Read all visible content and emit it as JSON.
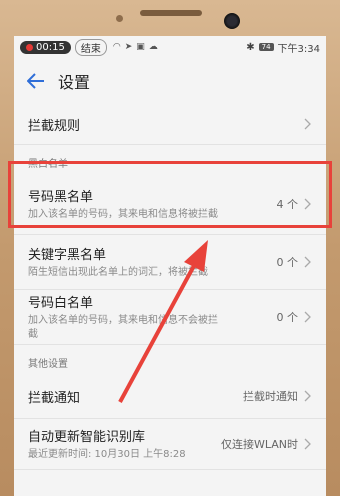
{
  "status": {
    "rec_time": "00:15",
    "end_label": "结束",
    "time": "下午3:34",
    "battery": "74"
  },
  "header": {
    "title": "设置"
  },
  "rows": [
    {
      "name": "拦截规则"
    },
    {
      "section": "黑白名单"
    },
    {
      "name": "号码黑名单",
      "desc": "加入该名单的号码，其来电和信息将被拦截",
      "value": "4 个"
    },
    {
      "name": "关键字黑名单",
      "desc": "陌生短信出现此名单上的词汇，将被拦截",
      "value": "0 个"
    },
    {
      "name": "号码白名单",
      "desc": "加入该名单的号码，其来电和信息不会被拦截",
      "value": "0 个"
    },
    {
      "section": "其他设置"
    },
    {
      "name": "拦截通知",
      "value": "拦截时通知"
    },
    {
      "name": "自动更新智能识别库",
      "desc": "最近更新时间: 10月30日 上午8:28",
      "value": "仅连接WLAN时"
    }
  ]
}
